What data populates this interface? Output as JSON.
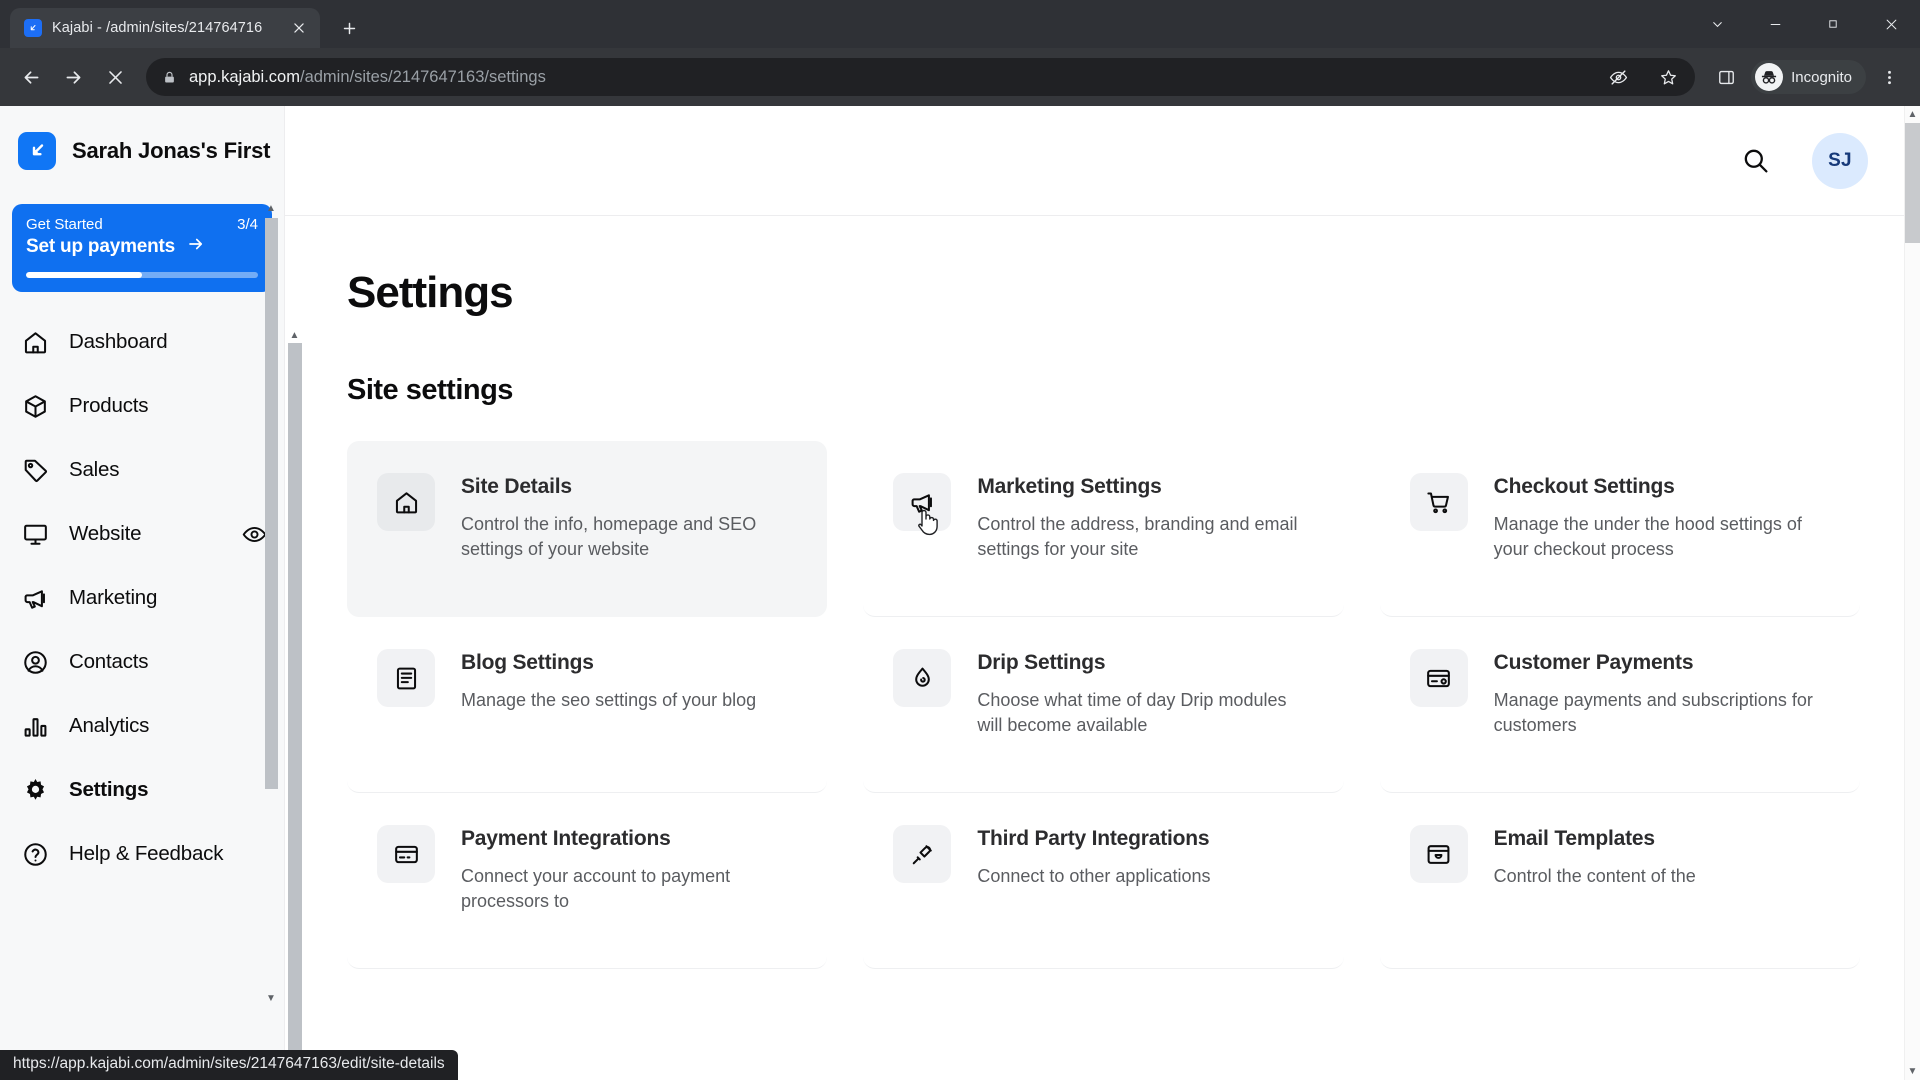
{
  "browser": {
    "tab": {
      "title": "Kajabi - /admin/sites/214764716",
      "favicon": "kajabi-logo-icon"
    },
    "new_tab_label": "+",
    "url_domain": "app.kajabi.com",
    "url_path": "/admin/sites/2147647163/settings",
    "profile_label": "Incognito",
    "icons": {
      "back": "back-arrow-icon",
      "forward": "forward-arrow-icon",
      "stop": "stop-loading-icon",
      "lock": "lock-icon",
      "tracking": "eye-slash-icon",
      "bookmark": "star-icon",
      "side_panel": "side-panel-icon",
      "menu": "three-dot-menu-icon"
    }
  },
  "status_bar": {
    "url": "https://app.kajabi.com/admin/sites/2147647163/edit/site-details"
  },
  "sidebar": {
    "brand": {
      "name": "Sarah Jonas's First",
      "logo": "kajabi-logo-icon"
    },
    "get_started": {
      "label": "Get Started",
      "count": "3/4",
      "cta": "Set up payments",
      "arrow": "arrow-right-icon",
      "progress_percent": 50
    },
    "items": [
      {
        "label": "Dashboard",
        "icon": "home-icon",
        "active": false
      },
      {
        "label": "Products",
        "icon": "box-icon",
        "active": false
      },
      {
        "label": "Sales",
        "icon": "tag-icon",
        "active": false
      },
      {
        "label": "Website",
        "icon": "monitor-icon",
        "active": false,
        "trailing_icon": "eye-icon"
      },
      {
        "label": "Marketing",
        "icon": "megaphone-icon",
        "active": false
      },
      {
        "label": "Contacts",
        "icon": "user-circle-icon",
        "active": false
      },
      {
        "label": "Analytics",
        "icon": "bar-chart-icon",
        "active": false
      },
      {
        "label": "Settings",
        "icon": "gear-icon",
        "active": true
      },
      {
        "label": "Help & Feedback",
        "icon": "question-circle-icon",
        "active": false
      }
    ]
  },
  "header": {
    "search_icon": "search-icon",
    "avatar_initials": "SJ"
  },
  "main": {
    "page_title": "Settings",
    "section_title": "Site settings",
    "cards": [
      {
        "title": "Site Details",
        "desc": "Control the info, homepage and SEO settings of your website",
        "icon": "home-icon",
        "hover": true
      },
      {
        "title": "Marketing Settings",
        "desc": "Control the address, branding and email settings for your site",
        "icon": "megaphone-icon",
        "hover": false
      },
      {
        "title": "Checkout Settings",
        "desc": "Manage the under the hood settings of your checkout process",
        "icon": "cart-icon",
        "hover": false
      },
      {
        "title": "Blog Settings",
        "desc": "Manage the seo settings of your blog",
        "icon": "book-icon",
        "hover": false
      },
      {
        "title": "Drip Settings",
        "desc": "Choose what time of day Drip modules will become available",
        "icon": "droplet-icon",
        "hover": false
      },
      {
        "title": "Customer Payments",
        "desc": "Manage payments and subscriptions for customers",
        "icon": "card-settings-icon",
        "hover": false
      },
      {
        "title": "Payment Integrations",
        "desc": "Connect your account to payment processors to",
        "icon": "credit-card-icon",
        "hover": false
      },
      {
        "title": "Third Party Integrations",
        "desc": "Connect to other applications",
        "icon": "plug-icon",
        "hover": false
      },
      {
        "title": "Email Templates",
        "desc": "Control the content of the",
        "icon": "email-archive-icon",
        "hover": false
      }
    ]
  },
  "colors": {
    "brand_blue": "#0f70f0",
    "chrome_dark": "#35373b",
    "avatar_bg": "#dbeafe",
    "card_hover": "#f4f5f6"
  }
}
